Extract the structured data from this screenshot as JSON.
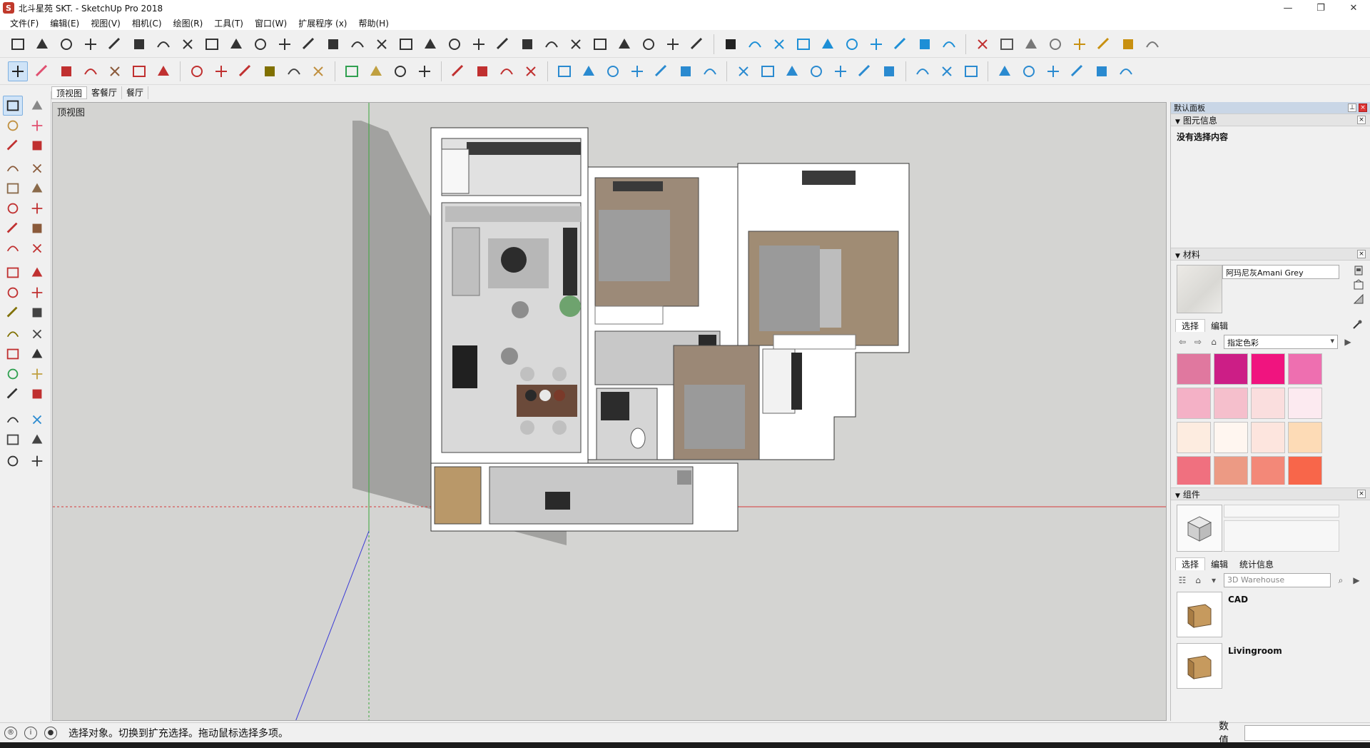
{
  "window": {
    "title": "北斗星苑 SKT. - SketchUp Pro 2018",
    "minimize": "—",
    "restore": "❐",
    "close": "✕"
  },
  "menu": [
    "文件(F)",
    "编辑(E)",
    "视图(V)",
    "相机(C)",
    "绘图(R)",
    "工具(T)",
    "窗口(W)",
    "扩展程序 (x)",
    "帮助(H)"
  ],
  "scene_tabs": [
    "顶视图",
    "客餐厅",
    "餐厅"
  ],
  "viewport": {
    "label": "顶视图"
  },
  "right_panel": {
    "header": "默认面板",
    "entity_info": {
      "title": "图元信息",
      "body": "没有选择内容"
    },
    "materials": {
      "title": "材料",
      "name": "阿玛尼灰Amani Grey",
      "tab_select": "选择",
      "tab_edit": "编辑",
      "dropdown": "指定色彩",
      "swatches": [
        "#e0789f",
        "#cc1e86",
        "#f0147f",
        "#ee6fb0",
        "#f4b1c6",
        "#f5bfcc",
        "#fadede",
        "#fceaf0",
        "#fdece0",
        "#fff6f0",
        "#fde5de",
        "#fddbb6",
        "#f0707f",
        "#ec9a84",
        "#f38878",
        "#f8664a"
      ]
    },
    "components": {
      "title": "组件",
      "tab_select": "选择",
      "tab_edit": "编辑",
      "tab_stats": "统计信息",
      "search_placeholder": "3D Warehouse",
      "items": [
        {
          "label": "CAD"
        },
        {
          "label": "Livingroom"
        }
      ]
    }
  },
  "status": {
    "text": "选择对象。切换到扩充选择。拖动鼠标选择多项。",
    "measure_label": "数值"
  },
  "colors": {
    "viewport_bg": "#d4d4d2",
    "panel_header": "#c9d6e6",
    "axis_red": "#d63a3a",
    "axis_green": "#3aa63a",
    "axis_blue": "#3a3ad6"
  }
}
